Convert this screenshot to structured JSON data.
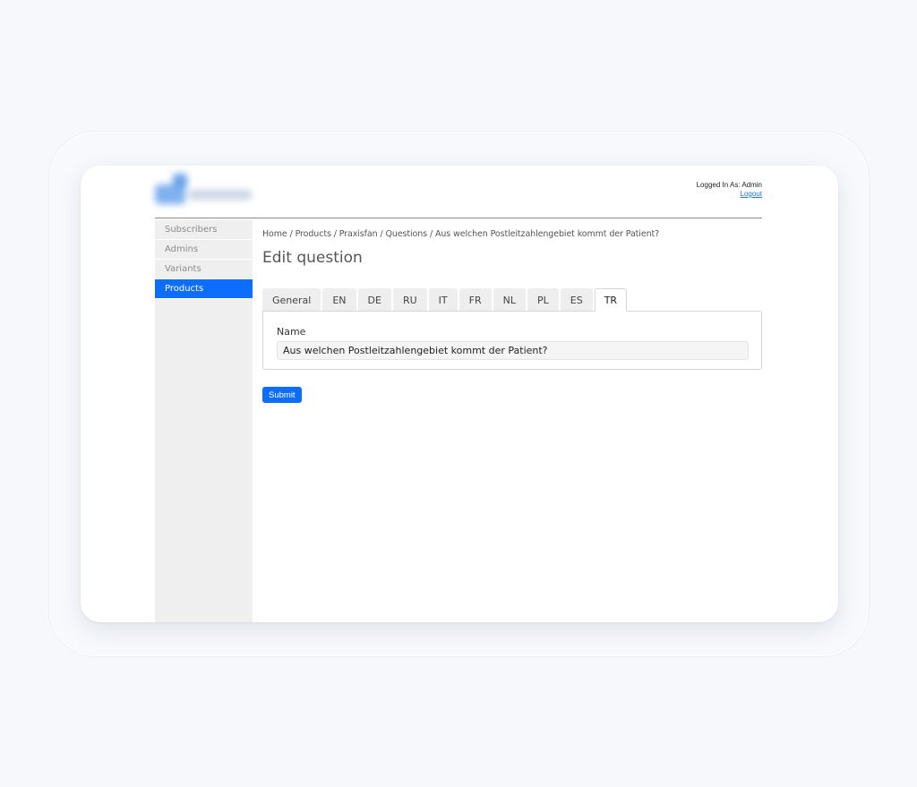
{
  "header": {
    "logged_in_text": "Logged In As: Admin",
    "logout_label": "Logout"
  },
  "sidebar": {
    "items": [
      {
        "label": "Subscribers"
      },
      {
        "label": "Admins"
      },
      {
        "label": "Variants"
      },
      {
        "label": "Products",
        "active": true
      }
    ]
  },
  "breadcrumb": "Home / Products / Praxisfan / Questions / Aus welchen Postleitzahlengebiet kommt der Patient?",
  "page_title": "Edit question",
  "tabs": [
    {
      "label": "General"
    },
    {
      "label": "EN"
    },
    {
      "label": "DE"
    },
    {
      "label": "RU"
    },
    {
      "label": "IT"
    },
    {
      "label": "FR"
    },
    {
      "label": "NL"
    },
    {
      "label": "PL"
    },
    {
      "label": "ES"
    },
    {
      "label": "TR",
      "active": true
    }
  ],
  "form": {
    "name_label": "Name",
    "name_value": "Aus welchen Postleitzahlengebiet kommt der Patient?"
  },
  "submit_label": "Submit",
  "colors": {
    "accent": "#0d6efd",
    "sidebar_bg": "#efefef",
    "page_bg": "#f6f8fb"
  }
}
